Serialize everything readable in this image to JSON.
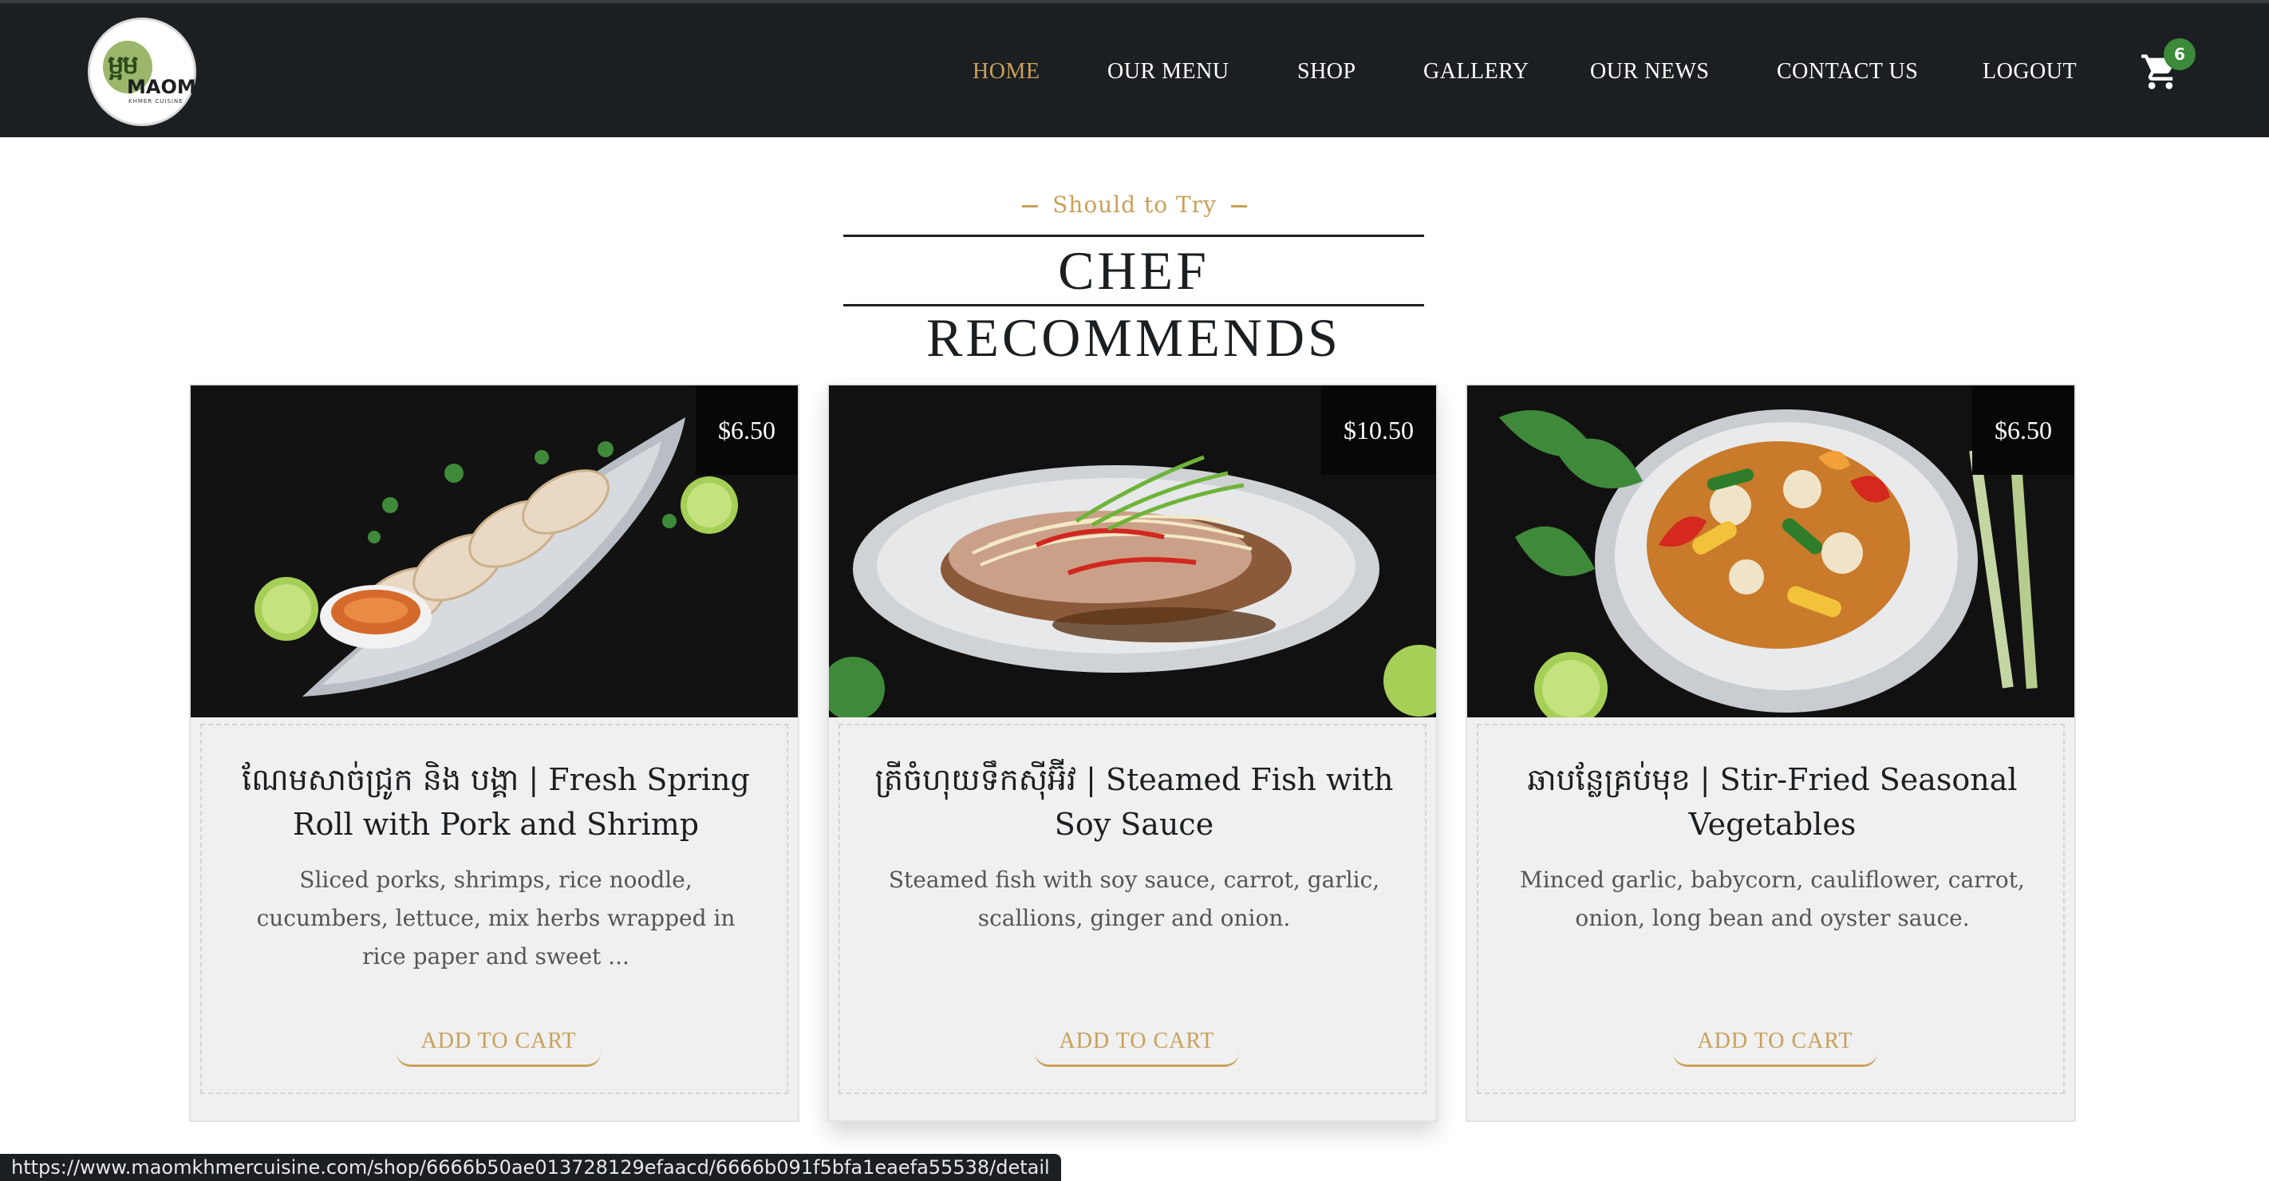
{
  "header": {
    "logo": {
      "khmer": "ម្អម",
      "word": "MAOM",
      "sub": "KHMER CUISINE"
    },
    "nav": [
      {
        "label": "HOME",
        "active": true
      },
      {
        "label": "OUR MENU",
        "active": false
      },
      {
        "label": "SHOP",
        "active": false
      },
      {
        "label": "GALLERY",
        "active": false
      },
      {
        "label": "OUR NEWS",
        "active": false
      },
      {
        "label": "CONTACT US",
        "active": false
      },
      {
        "label": "LOGOUT",
        "active": false
      }
    ],
    "cart_count": "6",
    "cart_icon": "shopping-cart-icon"
  },
  "section": {
    "eyebrow": "Should to Try",
    "title": "CHEF RECOMMENDS"
  },
  "cards": [
    {
      "price": "$6.50",
      "title": "ណែមសាច់ជ្រូក និង បង្គា | Fresh Spring Roll with Pork and Shrimp",
      "description": "Sliced porks, shrimps, rice noodle, cucumbers, lettuce, mix herbs wrapped in rice paper and sweet ...",
      "button": "ADD TO CART"
    },
    {
      "price": "$10.50",
      "title": "ត្រីចំហុយទឹកស៊ីអ៊ីវ | Steamed Fish with Soy Sauce",
      "description": "Steamed fish with soy sauce, carrot, garlic, scallions, ginger and onion.",
      "button": "ADD TO CART"
    },
    {
      "price": "$6.50",
      "title": "ឆាបន្លែគ្រប់មុខ | Stir-Fried Seasonal Vegetables",
      "description": "Minced garlic, babycorn, cauliflower, carrot, onion, long bean and oyster sauce.",
      "button": "ADD TO CART"
    }
  ],
  "status_url": "https://www.maomkhmercuisine.com/shop/6666b50ae013728129efaacd/6666b091f5bfa1eaefa55538/detail",
  "colors": {
    "accent": "#c9a05a",
    "header_bg": "#1b1f22",
    "badge": "#3d8a3a",
    "card_bg": "#f0f0f0"
  }
}
